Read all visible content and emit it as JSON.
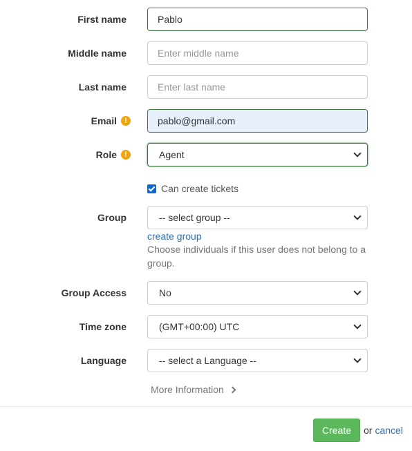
{
  "form": {
    "first_name": {
      "label": "First name",
      "value": "Pablo"
    },
    "middle_name": {
      "label": "Middle name",
      "placeholder": "Enter middle name"
    },
    "last_name": {
      "label": "Last name",
      "placeholder": "Enter last name"
    },
    "email": {
      "label": "Email",
      "value": "pablo@gmail.com",
      "warning_icon": "!"
    },
    "role": {
      "label": "Role",
      "value": "Agent",
      "warning_icon": "!"
    },
    "can_create_tickets": {
      "label": "Can create tickets",
      "checked": true
    },
    "group": {
      "label": "Group",
      "value": "-- select group --",
      "create_link": "create group",
      "help_text": "Choose individuals if this user does not belong to a group."
    },
    "group_access": {
      "label": "Group Access",
      "value": "No"
    },
    "time_zone": {
      "label": "Time zone",
      "value": "(GMT+00:00) UTC"
    },
    "language": {
      "label": "Language",
      "value": "-- select a Language --"
    },
    "more_information": "More Information"
  },
  "footer": {
    "create_label": "Create",
    "or_text": "or",
    "cancel_label": "cancel"
  },
  "colors": {
    "valid_border": "#3c763d",
    "autofill_bg": "#e8f0fe",
    "warning": "#f0a30a",
    "create_button": "#5cb85c",
    "link": "#2a6ebb",
    "checkbox": "#0b6bd6"
  },
  "icons": {
    "warning": "warning-circle-icon",
    "select_arrow": "chevron-down-icon",
    "more": "chevron-right-icon"
  }
}
